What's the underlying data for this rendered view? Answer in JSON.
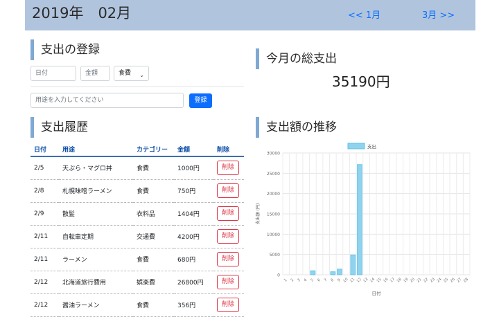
{
  "header": {
    "month": "2019年　02月",
    "prev": "<< 1月",
    "next": "3月 >>"
  },
  "register": {
    "title": "支出の登録",
    "date_placeholder": "日付",
    "amount_placeholder": "金額",
    "category_selected": "食費",
    "purpose_placeholder": "用途を入力してください",
    "submit": "登録"
  },
  "total": {
    "title": "今月の総支出",
    "value": "35190円"
  },
  "history": {
    "title": "支出履歴",
    "columns": [
      "日付",
      "用途",
      "カテゴリー",
      "金額",
      "削除"
    ],
    "delete_label": "削除",
    "rows": [
      {
        "date": "2/5",
        "purpose": "天ぷら・マグロ丼",
        "category": "食費",
        "amount": "1000円"
      },
      {
        "date": "2/8",
        "purpose": "札幌味噌ラーメン",
        "category": "食費",
        "amount": "750円"
      },
      {
        "date": "2/9",
        "purpose": "散髪",
        "category": "衣料品",
        "amount": "1404円"
      },
      {
        "date": "2/11",
        "purpose": "自転車定期",
        "category": "交通費",
        "amount": "4200円"
      },
      {
        "date": "2/11",
        "purpose": "ラーメン",
        "category": "食費",
        "amount": "680円"
      },
      {
        "date": "2/12",
        "purpose": "北海道旅行費用",
        "category": "娯楽費",
        "amount": "26800円"
      },
      {
        "date": "2/12",
        "purpose": "醤油ラーメン",
        "category": "食費",
        "amount": "356円"
      }
    ]
  },
  "chart_section": {
    "title": "支出額の推移"
  },
  "chart_data": {
    "type": "bar",
    "legend": "支出",
    "legend_position": "top",
    "xlabel": "日付",
    "ylabel": "支出額 (円)",
    "ylim": [
      0,
      30000
    ],
    "yticks": [
      0,
      5000,
      10000,
      15000,
      20000,
      25000,
      30000
    ],
    "categories": [
      "1",
      "2",
      "3",
      "4",
      "5",
      "6",
      "7",
      "8",
      "9",
      "10",
      "11",
      "12",
      "13",
      "14",
      "15",
      "16",
      "17",
      "18",
      "19",
      "20",
      "21",
      "22",
      "23",
      "24",
      "25",
      "26",
      "27",
      "28"
    ],
    "values": [
      0,
      0,
      0,
      0,
      1000,
      0,
      0,
      750,
      1404,
      0,
      4880,
      27156,
      0,
      0,
      0,
      0,
      0,
      0,
      0,
      0,
      0,
      0,
      0,
      0,
      0,
      0,
      0,
      0
    ],
    "bar_color": "#8fd3ee",
    "bar_border": "#5bc0e6",
    "grid": true
  }
}
